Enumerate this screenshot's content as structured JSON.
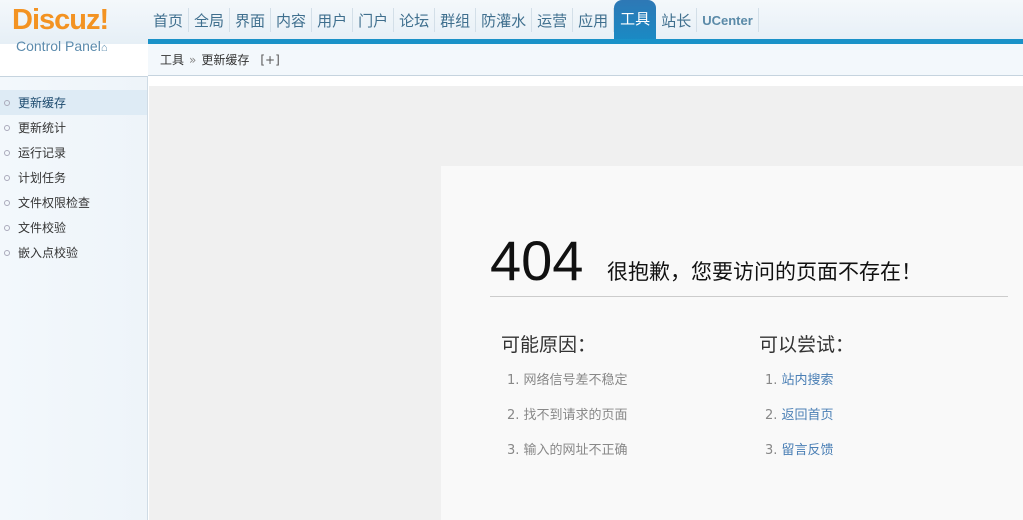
{
  "logo": {
    "brand": "Discuz!",
    "subtitle": "Control Panel"
  },
  "nav": {
    "tabs": [
      "首页",
      "全局",
      "界面",
      "内容",
      "用户",
      "门户",
      "论坛",
      "群组",
      "防灌水",
      "运营",
      "应用",
      "工具",
      "站长",
      "UCenter"
    ],
    "active": "工具"
  },
  "breadcrumb": {
    "parent": "工具",
    "separator": "»",
    "current": "更新缓存",
    "add": "[+]"
  },
  "sidebar": {
    "items": [
      "更新缓存",
      "更新统计",
      "运行记录",
      "计划任务",
      "文件权限检查",
      "文件校验",
      "嵌入点校验"
    ],
    "active": "更新缓存"
  },
  "error": {
    "code": "404",
    "message": "很抱歉，您要访问的页面不存在！",
    "reasons": {
      "title": "可能原因：",
      "items": [
        "1. 网络信号差不稳定",
        "2. 找不到请求的页面",
        "3. 输入的网址不正确"
      ]
    },
    "tries": {
      "title": "可以尝试：",
      "items": [
        {
          "num": "1. ",
          "label": "站内搜索"
        },
        {
          "num": "2. ",
          "label": "返回首页"
        },
        {
          "num": "3. ",
          "label": "留言反馈"
        }
      ]
    }
  },
  "colors": {
    "accent": "#1a92c8",
    "logo": "#f39322",
    "link": "#4a7fb5"
  }
}
